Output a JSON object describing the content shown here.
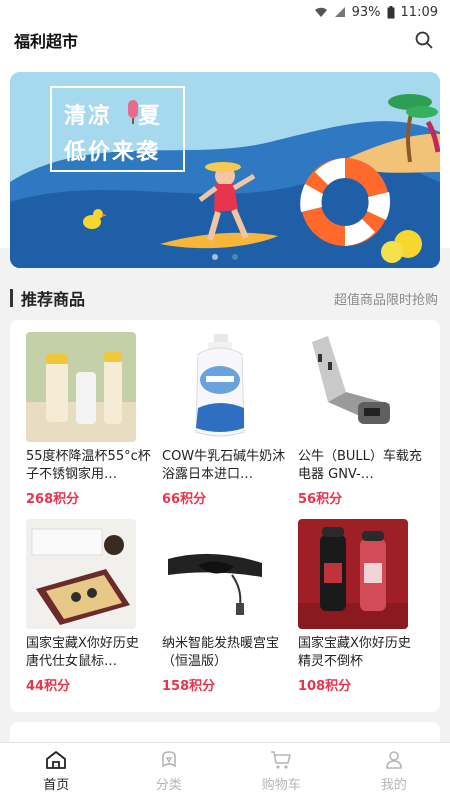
{
  "status_bar": {
    "battery": "93%",
    "time": "11:09"
  },
  "header": {
    "title": "福利超市"
  },
  "banner": {
    "line1": "清凉",
    "line1b": "夏",
    "line2": "低价来袭"
  },
  "section": {
    "title": "推荐商品",
    "more": "超值商品限时抢购"
  },
  "products": [
    {
      "name": "55度杯降温杯55°c杯子不锈钢家用…",
      "price": "268积分"
    },
    {
      "name": "COW牛乳石碱牛奶沐浴露日本进口…",
      "price": "66积分"
    },
    {
      "name": "公牛（BULL）车载充电器 GNV-…",
      "price": "56积分"
    },
    {
      "name": "国家宝藏X你好历史 唐代仕女鼠标…",
      "price": "44积分"
    },
    {
      "name": "纳米智能发热暖宫宝（恒温版）",
      "price": "158积分"
    },
    {
      "name": "国家宝藏X你好历史 精灵不倒杯",
      "price": "108积分"
    }
  ],
  "tabs": [
    {
      "label": "首页",
      "icon": "home-icon"
    },
    {
      "label": "分类",
      "icon": "category-icon"
    },
    {
      "label": "购物车",
      "icon": "cart-icon"
    },
    {
      "label": "我的",
      "icon": "user-icon"
    }
  ],
  "colors": {
    "price": "#e9344d",
    "active_tab": "#222222",
    "inactive_tab": "#b6b6b6"
  }
}
